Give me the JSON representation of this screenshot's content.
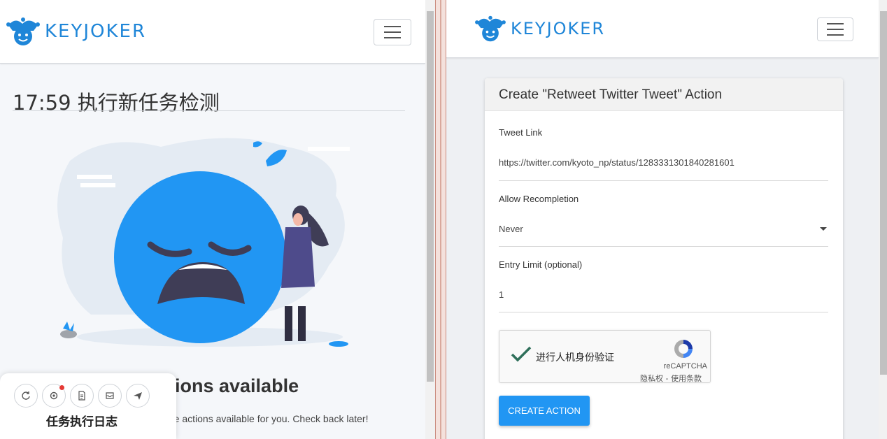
{
  "left": {
    "brand": "KEYJOKER",
    "title": "17:59 执行新任务检测",
    "no_actions_title": "ions available",
    "no_actions_text": "re actions available for you. Check back later!",
    "log_panel": {
      "title": "任务执行日志",
      "icons": [
        "refresh-icon",
        "settings-icon",
        "document-icon",
        "inbox-icon",
        "send-icon"
      ]
    }
  },
  "right": {
    "brand": "KEYJOKER",
    "card_title": "Create \"Retweet Twitter Tweet\" Action",
    "fields": {
      "tweet_link": {
        "label": "Tweet Link",
        "value": "https://twitter.com/kyoto_np/status/1283331301840281601"
      },
      "allow_recompletion": {
        "label": "Allow Recompletion",
        "value": "Never"
      },
      "entry_limit": {
        "label": "Entry Limit (optional)",
        "value": "1"
      }
    },
    "captcha": {
      "text": "进行人机身份验证",
      "brand": "reCAPTCHA",
      "links": "隐私权 - 使用条款"
    },
    "create_button": "CREATE ACTION"
  },
  "colors": {
    "brand_blue": "#1f86d8",
    "button_blue": "#2196f3",
    "emoji_blue": "#2196f3"
  }
}
